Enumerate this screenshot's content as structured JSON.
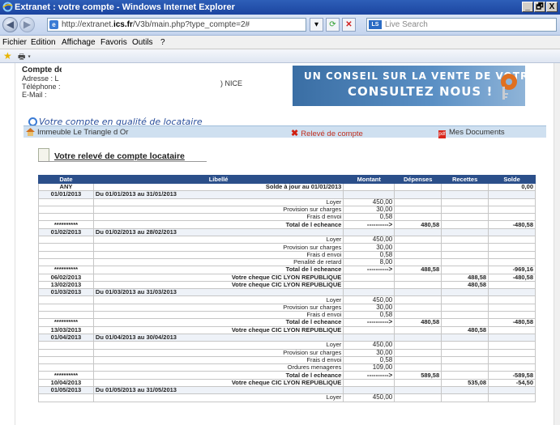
{
  "window": {
    "title": "Extranet : votre compte - Windows Internet Explorer",
    "controls": [
      "_",
      "🗗",
      "X"
    ]
  },
  "address_bar": {
    "url_prefix": "http://extranet.",
    "url_domain": "ics.fr",
    "url_suffix": "/V3b/main.php?type_compte=2#",
    "search_placeholder": "Live Search"
  },
  "menu": [
    "Fichier",
    "Edition",
    "Affichage",
    "Favoris",
    "Outils",
    "?"
  ],
  "account": {
    "name": "Compte de",
    "address_label": "Adresse : L",
    "phone_label": "Téléphone :",
    "email_label": "E-Mail :",
    "city": ") NICE"
  },
  "banner": {
    "line1": "UN CONSEIL SUR LA VENTE DE VOTRE BIEN ?",
    "line2": "CONSULTEZ NOUS !"
  },
  "section_title": "Votre compte en qualité de locataire",
  "tabs": {
    "building": "Immeuble Le Triangle d Or",
    "statement": "Relevé de compte",
    "documents": "Mes Documents"
  },
  "statement_title": "Votre relevé de compte locataire",
  "table": {
    "headers": [
      "Date",
      "Libellé",
      "Montant",
      "Dépenses",
      "Recettes",
      "Solde"
    ],
    "rows": [
      {
        "date": "ANY",
        "lib": "Solde à jour au 01/01/2013",
        "mont": "",
        "dep": "",
        "rec": "",
        "sol": "0,00",
        "kind": "bold"
      },
      {
        "date": "01/01/2013",
        "lib": "Du 01/01/2013 au 31/01/2013",
        "mont": "",
        "dep": "",
        "rec": "",
        "sol": "",
        "kind": "period"
      },
      {
        "date": "",
        "lib": "Loyer",
        "mont": "450,00",
        "dep": "",
        "rec": "",
        "sol": "",
        "kind": "item"
      },
      {
        "date": "",
        "lib": "Provision sur charges",
        "mont": "30,00",
        "dep": "",
        "rec": "",
        "sol": "",
        "kind": "item"
      },
      {
        "date": "",
        "lib": "Frais d envoi",
        "mont": "0,58",
        "dep": "",
        "rec": "",
        "sol": "",
        "kind": "item"
      },
      {
        "date": "**********",
        "lib": "Total de l echeance",
        "mont": "---------->",
        "dep": "480,58",
        "rec": "",
        "sol": "-480,58",
        "kind": "bold"
      },
      {
        "date": "01/02/2013",
        "lib": "Du 01/02/2013 au 28/02/2013",
        "mont": "",
        "dep": "",
        "rec": "",
        "sol": "",
        "kind": "period"
      },
      {
        "date": "",
        "lib": "Loyer",
        "mont": "450,00",
        "dep": "",
        "rec": "",
        "sol": "",
        "kind": "item"
      },
      {
        "date": "",
        "lib": "Provision sur charges",
        "mont": "30,00",
        "dep": "",
        "rec": "",
        "sol": "",
        "kind": "item"
      },
      {
        "date": "",
        "lib": "Frais d envoi",
        "mont": "0,58",
        "dep": "",
        "rec": "",
        "sol": "",
        "kind": "item"
      },
      {
        "date": "",
        "lib": "Penalité de retard",
        "mont": "8,00",
        "dep": "",
        "rec": "",
        "sol": "",
        "kind": "item"
      },
      {
        "date": "**********",
        "lib": "Total de l echeance",
        "mont": "---------->",
        "dep": "488,58",
        "rec": "",
        "sol": "-969,16",
        "kind": "bold"
      },
      {
        "date": "06/02/2013",
        "lib": "Votre cheque CIC LYON REPUBLIQUE",
        "mont": "",
        "dep": "",
        "rec": "488,58",
        "sol": "-480,58",
        "kind": "bold"
      },
      {
        "date": "13/02/2013",
        "lib": "Votre cheque CIC LYON REPUBLIQUE",
        "mont": "",
        "dep": "",
        "rec": "480,58",
        "sol": "",
        "kind": "bold"
      },
      {
        "date": "01/03/2013",
        "lib": "Du 01/03/2013 au 31/03/2013",
        "mont": "",
        "dep": "",
        "rec": "",
        "sol": "",
        "kind": "period"
      },
      {
        "date": "",
        "lib": "Loyer",
        "mont": "450,00",
        "dep": "",
        "rec": "",
        "sol": "",
        "kind": "item"
      },
      {
        "date": "",
        "lib": "Provision sur charges",
        "mont": "30,00",
        "dep": "",
        "rec": "",
        "sol": "",
        "kind": "item"
      },
      {
        "date": "",
        "lib": "Frais d envoi",
        "mont": "0,58",
        "dep": "",
        "rec": "",
        "sol": "",
        "kind": "item"
      },
      {
        "date": "**********",
        "lib": "Total de l echeance",
        "mont": "---------->",
        "dep": "480,58",
        "rec": "",
        "sol": "-480,58",
        "kind": "bold"
      },
      {
        "date": "13/03/2013",
        "lib": "Votre cheque CIC LYON REPUBLIQUE",
        "mont": "",
        "dep": "",
        "rec": "480,58",
        "sol": "",
        "kind": "bold"
      },
      {
        "date": "01/04/2013",
        "lib": "Du 01/04/2013 au 30/04/2013",
        "mont": "",
        "dep": "",
        "rec": "",
        "sol": "",
        "kind": "period"
      },
      {
        "date": "",
        "lib": "Loyer",
        "mont": "450,00",
        "dep": "",
        "rec": "",
        "sol": "",
        "kind": "item"
      },
      {
        "date": "",
        "lib": "Provision sur charges",
        "mont": "30,00",
        "dep": "",
        "rec": "",
        "sol": "",
        "kind": "item"
      },
      {
        "date": "",
        "lib": "Frais d envoi",
        "mont": "0,58",
        "dep": "",
        "rec": "",
        "sol": "",
        "kind": "item"
      },
      {
        "date": "",
        "lib": "Ordures menageres",
        "mont": "109,00",
        "dep": "",
        "rec": "",
        "sol": "",
        "kind": "item"
      },
      {
        "date": "**********",
        "lib": "Total de l echeance",
        "mont": "---------->",
        "dep": "589,58",
        "rec": "",
        "sol": "-589,58",
        "kind": "bold"
      },
      {
        "date": "10/04/2013",
        "lib": "Votre cheque CIC LYON REPUBLIQUE",
        "mont": "",
        "dep": "",
        "rec": "535,08",
        "sol": "-54,50",
        "kind": "bold"
      },
      {
        "date": "01/05/2013",
        "lib": "Du 01/05/2013 au 31/05/2013",
        "mont": "",
        "dep": "",
        "rec": "",
        "sol": "",
        "kind": "period"
      },
      {
        "date": "",
        "lib": "Loyer",
        "mont": "450,00",
        "dep": "",
        "rec": "",
        "sol": "",
        "kind": "item"
      }
    ]
  }
}
